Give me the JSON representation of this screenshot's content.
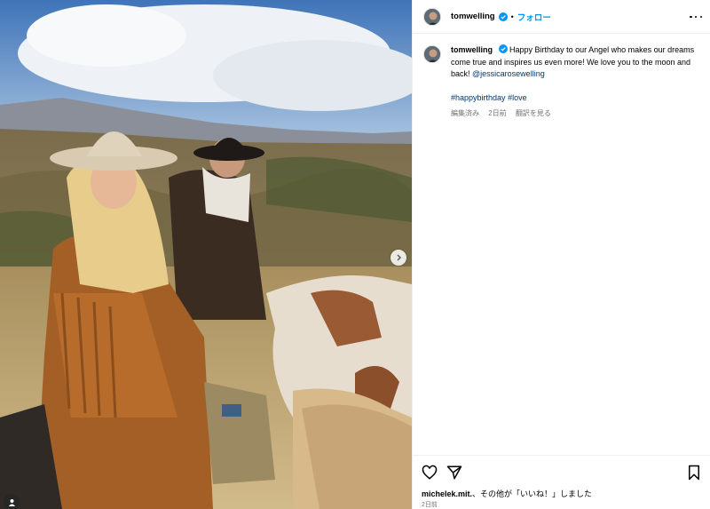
{
  "post": {
    "username": "tomwelling",
    "follow_label": "フォロー",
    "dot": "•"
  },
  "caption": {
    "username": "tomwelling",
    "text": "Happy Birthday to our Angel who makes our dreams come true and inspires us even more! We love you to the moon and back!",
    "mention": "@jessicarosewelling",
    "hashtags": [
      "#happybirthday",
      "#love"
    ],
    "edited": "編集済み",
    "time": "2日前",
    "see_translation": "翻訳を見る"
  },
  "likes": {
    "user": "michelek.mit.",
    "rest": "、その他が「いいね！」しました"
  },
  "date": "2日前",
  "icons": {
    "more": "more-options-icon",
    "like": "heart-icon",
    "share": "send-icon",
    "save": "bookmark-icon",
    "next": "chevron-right-icon",
    "tag": "user-tag-icon",
    "verified": "verified-badge-icon"
  },
  "colors": {
    "link": "#0095f6",
    "mention": "#00376b",
    "muted": "#737373"
  }
}
